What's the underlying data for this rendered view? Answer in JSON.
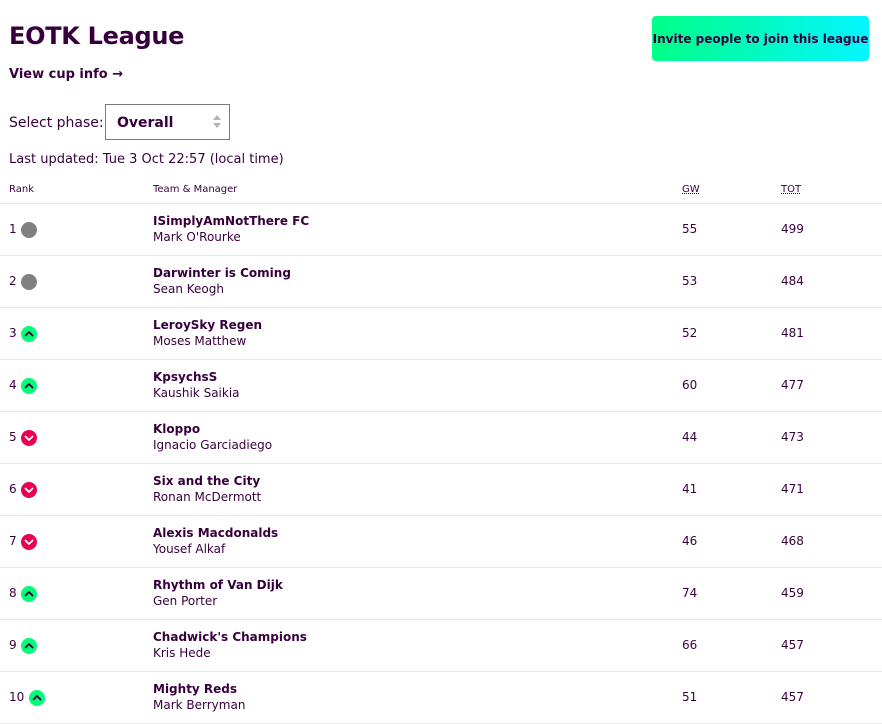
{
  "league": {
    "title": "EOTK League",
    "cup_link": "View cup info →",
    "invite_button": "Invite people to join this league",
    "phase_label": "Select phase:",
    "phase_selected": "Overall",
    "last_updated": "Last updated: Tue 3 Oct 22:57 (local time)"
  },
  "table": {
    "headers": {
      "rank": "Rank",
      "team": "Team & Manager",
      "gw": "GW",
      "tot": "TOT"
    },
    "rows": [
      {
        "rank": "1",
        "movement": "same",
        "team": "ISimplyAmNotThere FC",
        "manager": "Mark O'Rourke",
        "gw": "55",
        "tot": "499"
      },
      {
        "rank": "2",
        "movement": "same",
        "team": "Darwinter is Coming",
        "manager": "Sean Keogh",
        "gw": "53",
        "tot": "484"
      },
      {
        "rank": "3",
        "movement": "up",
        "team": "LeroySky Regen",
        "manager": "Moses Matthew",
        "gw": "52",
        "tot": "481"
      },
      {
        "rank": "4",
        "movement": "up",
        "team": "KpsychsS",
        "manager": "Kaushik Saikia",
        "gw": "60",
        "tot": "477"
      },
      {
        "rank": "5",
        "movement": "down",
        "team": "Kloppo",
        "manager": "Ignacio Garciadiego",
        "gw": "44",
        "tot": "473"
      },
      {
        "rank": "6",
        "movement": "down",
        "team": "Six and the City",
        "manager": "Ronan McDermott",
        "gw": "41",
        "tot": "471"
      },
      {
        "rank": "7",
        "movement": "down",
        "team": "Alexis Macdonalds",
        "manager": "Yousef Alkaf",
        "gw": "46",
        "tot": "468"
      },
      {
        "rank": "8",
        "movement": "up",
        "team": "Rhythm of Van Dijk",
        "manager": "Gen Porter",
        "gw": "74",
        "tot": "459"
      },
      {
        "rank": "9",
        "movement": "up",
        "team": "Chadwick's Champions",
        "manager": "Kris Hede",
        "gw": "66",
        "tot": "457"
      },
      {
        "rank": "10",
        "movement": "up",
        "team": "Mighty Reds",
        "manager": "Mark Berryman",
        "gw": "51",
        "tot": "457"
      }
    ]
  },
  "colors": {
    "brand": "#37003c",
    "up": "#01fc7a",
    "down": "#e90052",
    "same": "#808080",
    "invite_gradient": [
      "#00ff87",
      "#04f5ff"
    ]
  }
}
